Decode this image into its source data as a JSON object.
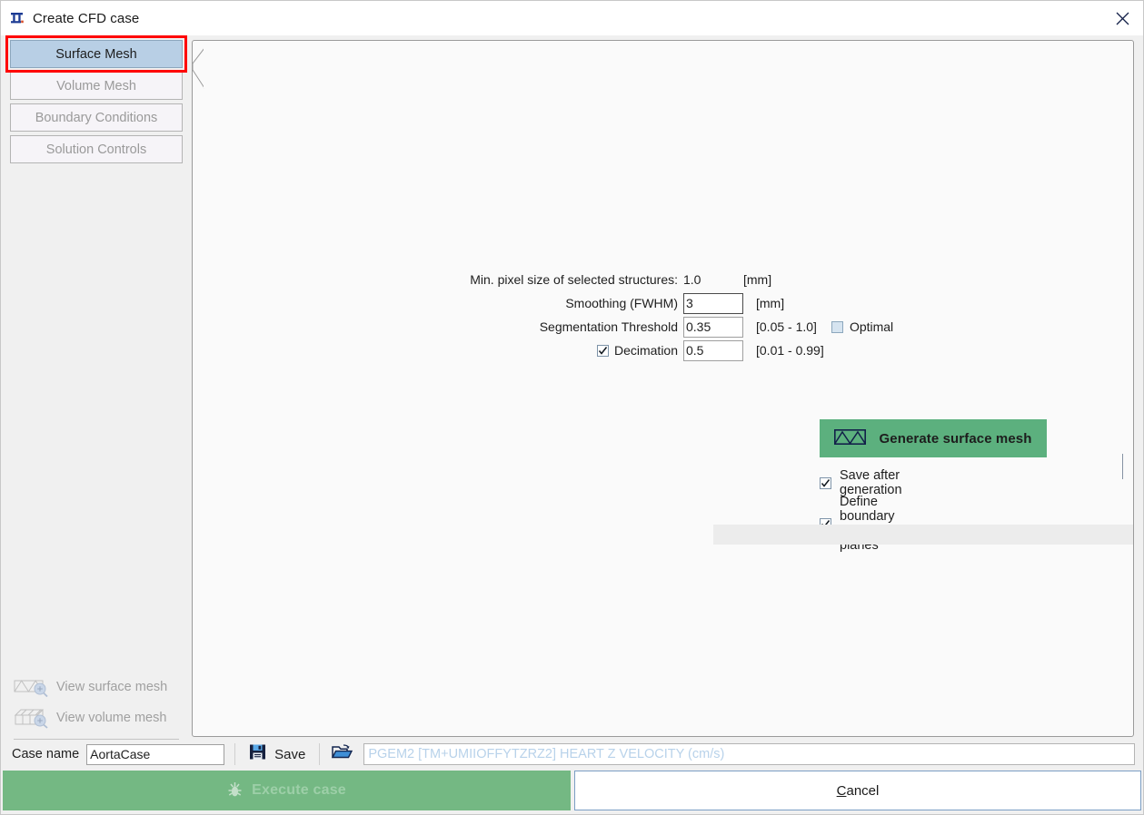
{
  "window": {
    "title": "Create CFD case",
    "icon": "cfd-app-icon",
    "close_icon": "close-icon"
  },
  "sidebar": {
    "tabs": [
      {
        "label": "Surface Mesh",
        "active": true,
        "highlighted": true
      },
      {
        "label": "Volume Mesh",
        "active": false,
        "highlighted": false
      },
      {
        "label": "Boundary Conditions",
        "active": false,
        "highlighted": false
      },
      {
        "label": "Solution Controls",
        "active": false,
        "highlighted": false
      }
    ],
    "view_links": [
      {
        "label": "View surface mesh",
        "icon": "surface-mesh-zoom-icon",
        "enabled": false
      },
      {
        "label": "View volume mesh",
        "icon": "volume-mesh-zoom-icon",
        "enabled": false
      }
    ]
  },
  "form": {
    "min_pixel_size": {
      "label": "Min. pixel size of selected structures:",
      "value": "1.0",
      "unit": "[mm]"
    },
    "smoothing": {
      "label": "Smoothing (FWHM)",
      "value": "3",
      "unit": "[mm]",
      "focused": true
    },
    "segmentation_threshold": {
      "label": "Segmentation Threshold",
      "value": "0.35",
      "range": "[0.05 - 1.0]",
      "optimal_label": "Optimal",
      "optimal_checked": false
    },
    "decimation": {
      "label": "Decimation",
      "value": "0.5",
      "range": "[0.01 - 0.99]",
      "checked": true
    },
    "generate_button": {
      "label": "Generate surface mesh",
      "icon": "surface-mesh-icon",
      "color": "#5cb07e"
    },
    "options": [
      {
        "label": "Save after generation",
        "checked": true
      },
      {
        "label": "Define boundary conditions planes",
        "checked": true
      }
    ],
    "progress": {
      "value": 0
    }
  },
  "footer": {
    "case_name_label": "Case name",
    "case_name_value": "AortaCase",
    "case_name_placeholder": "",
    "save_label": "Save",
    "save_icon": "floppy-disk-icon",
    "open_icon": "folder-open-icon",
    "status_text": "PGEM2 [TM+UMIIOFFYTZRZ2] HEART Z VELOCITY (cm/s)"
  },
  "actions": {
    "execute": {
      "label": "Execute case",
      "icon": "execute-icon",
      "enabled": false,
      "color": "#74b883"
    },
    "cancel": {
      "label_prefix": "C",
      "label_rest": "ancel"
    }
  }
}
